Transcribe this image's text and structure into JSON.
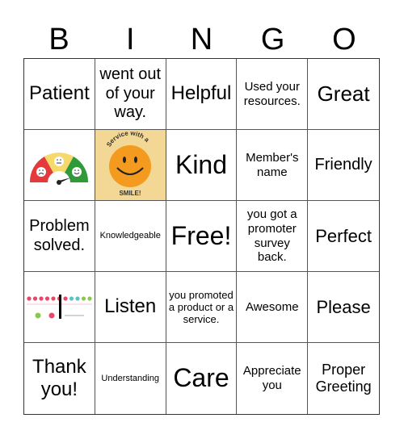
{
  "header": [
    "B",
    "I",
    "N",
    "G",
    "O"
  ],
  "cells": [
    {
      "text": "Patient"
    },
    {
      "text": "went out of your way."
    },
    {
      "text": "Helpful"
    },
    {
      "text": "Used your resources."
    },
    {
      "text": "Great"
    },
    {
      "image": "satisfaction-gauge-icon"
    },
    {
      "image": "service-with-a-smile-image",
      "text_top": "Service with a",
      "text_bottom": "SMILE!"
    },
    {
      "text": "Kind"
    },
    {
      "text": "Member's name"
    },
    {
      "text": "Friendly"
    },
    {
      "text": "Problem solved."
    },
    {
      "text": "Knowledgeable"
    },
    {
      "text": "Free!"
    },
    {
      "text": "you got a promoter survey back."
    },
    {
      "text": "Perfect"
    },
    {
      "image": "nps-scale-image"
    },
    {
      "text": "Listen"
    },
    {
      "text": "you promoted a product or a service."
    },
    {
      "text": "Awesome"
    },
    {
      "text": "Please"
    },
    {
      "text": "Thank you!"
    },
    {
      "text": "Understanding"
    },
    {
      "text": "Care"
    },
    {
      "text": "Appreciate you"
    },
    {
      "text": "Proper Greeting"
    }
  ],
  "colors": {
    "gauge_red": "#e33b3b",
    "gauge_yellow": "#f5d96a",
    "gauge_green": "#2e9a3a",
    "smile_bg": "#f3d795",
    "smile_face": "#f49a1e"
  }
}
